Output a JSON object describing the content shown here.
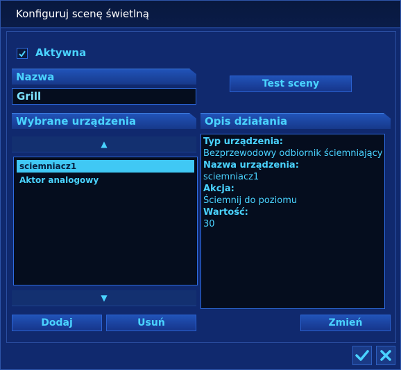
{
  "window": {
    "title": "Konfiguruj scenę świetlną"
  },
  "active_checkbox": {
    "label": "Aktywna",
    "checked": true
  },
  "name_section": {
    "header": "Nazwa",
    "value": "Grill"
  },
  "test_button": {
    "label": "Test sceny"
  },
  "devices_section": {
    "header": "Wybrane urządzenia",
    "up_arrow": "▲",
    "down_arrow": "▼",
    "items": [
      {
        "label": "sciemniacz1",
        "selected": true
      },
      {
        "label": "Aktor analogowy",
        "selected": false
      }
    ],
    "add_button": "Dodaj",
    "remove_button": "Usuń"
  },
  "description_section": {
    "header": "Opis działania",
    "device_type_label": "Typ urządzenia:",
    "device_type_value": "Bezprzewodowy odbiornik ściemniający",
    "device_name_label": "Nazwa urządzenia:",
    "device_name_value": "sciemniacz1",
    "action_label": "Akcja:",
    "action_value": "Ściemnij do poziomu",
    "value_label": "Wartość:",
    "value_value": "30",
    "change_button": "Zmień"
  },
  "footer": {
    "ok_icon": "check-icon",
    "cancel_icon": "close-icon"
  },
  "colors": {
    "accent": "#4ad3ff",
    "background": "#10296e",
    "selected": "#40c8f4"
  }
}
